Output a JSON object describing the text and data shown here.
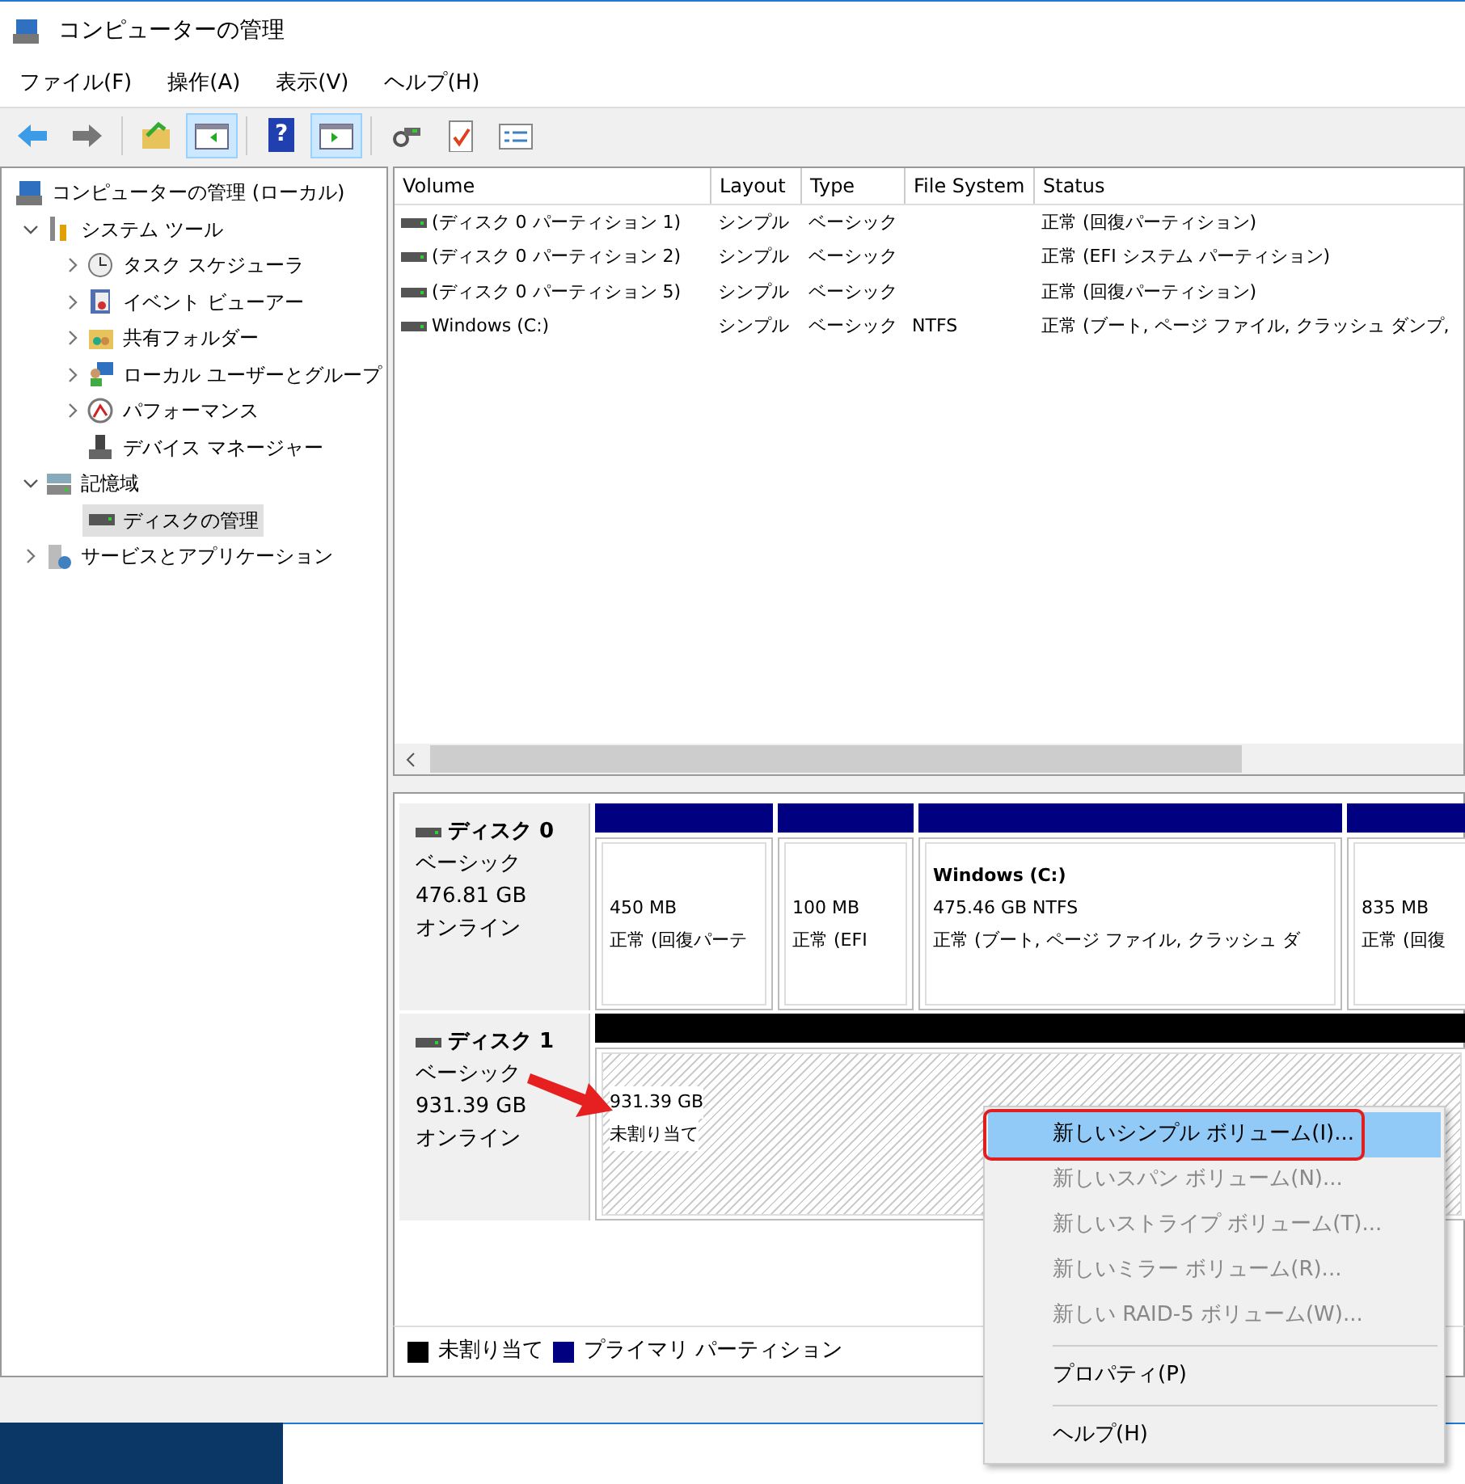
{
  "window": {
    "title": "コンピューターの管理"
  },
  "menu": [
    "ファイル(F)",
    "操作(A)",
    "表示(V)",
    "ヘルプ(H)"
  ],
  "toolbar": [
    {
      "kind": "back",
      "selected": false
    },
    {
      "kind": "forward",
      "selected": false
    },
    {
      "kind": "sep"
    },
    {
      "kind": "up",
      "selected": false
    },
    {
      "kind": "tree",
      "selected": true
    },
    {
      "kind": "sep"
    },
    {
      "kind": "help",
      "glyph": "?",
      "selected": false
    },
    {
      "kind": "pane",
      "selected": true
    },
    {
      "kind": "sep"
    },
    {
      "kind": "connect",
      "selected": false
    },
    {
      "kind": "check",
      "selected": false
    },
    {
      "kind": "list",
      "selected": false
    }
  ],
  "tree": [
    {
      "label": "コンピューターの管理 (ローカル)",
      "kind": "computer",
      "selected": false,
      "children": [
        {
          "label": "システム ツール",
          "kind": "tools",
          "expanded": true,
          "selected": false,
          "children": [
            {
              "label": "タスク スケジューラ",
              "kind": "clock",
              "expanded": false,
              "selected": false
            },
            {
              "label": "イベント ビューアー",
              "kind": "log",
              "expanded": false,
              "selected": false
            },
            {
              "label": "共有フォルダー",
              "kind": "folder",
              "expanded": false,
              "selected": false
            },
            {
              "label": "ローカル ユーザーとグループ",
              "kind": "users",
              "expanded": false,
              "selected": false
            },
            {
              "label": "パフォーマンス",
              "kind": "gauge",
              "expanded": false,
              "selected": false
            },
            {
              "label": "デバイス マネージャー",
              "kind": "device",
              "selected": false
            }
          ]
        },
        {
          "label": "記憶域",
          "kind": "storage",
          "expanded": true,
          "selected": false,
          "children": [
            {
              "label": "ディスクの管理",
              "kind": "disk",
              "selected": true
            }
          ]
        },
        {
          "label": "サービスとアプリケーション",
          "kind": "services",
          "expanded": false,
          "selected": false
        }
      ]
    }
  ],
  "volumes": {
    "columns": [
      "Volume",
      "Layout",
      "Type",
      "File System",
      "Status"
    ],
    "rows": [
      [
        "(ディスク 0 パーティション 1)",
        "シンプル",
        "ベーシック",
        "",
        "正常 (回復パーティション)"
      ],
      [
        "(ディスク 0 パーティション 2)",
        "シンプル",
        "ベーシック",
        "",
        "正常 (EFI システム パーティション)"
      ],
      [
        "(ディスク 0 パーティション 5)",
        "シンプル",
        "ベーシック",
        "",
        "正常 (回復パーティション)"
      ],
      [
        "Windows (C:)",
        "シンプル",
        "ベーシック",
        "NTFS",
        "正常 (ブート, ページ ファイル, クラッシュ ダンプ,"
      ]
    ]
  },
  "disks": [
    {
      "name": "ディスク 0",
      "type": "ベーシック",
      "size": "476.81 GB",
      "status": "オンライン",
      "partitions": [
        {
          "kind": "primary",
          "size": "450 MB",
          "status": "正常 (回復パーテ"
        },
        {
          "kind": "primary",
          "size": "100 MB",
          "status": "正常 (EFI"
        },
        {
          "kind": "primary",
          "name": "Windows  (C:)",
          "size": "475.46 GB NTFS",
          "status": "正常 (ブート, ページ ファイル, クラッシュ ダ"
        },
        {
          "kind": "primary",
          "size": "835 MB",
          "status": "正常 (回復"
        }
      ]
    },
    {
      "name": "ディスク 1",
      "type": "ベーシック",
      "size": "931.39 GB",
      "status": "オンライン",
      "partitions": [
        {
          "kind": "unallocated",
          "size": "931.39 GB",
          "status": "未割り当て"
        }
      ]
    }
  ],
  "legend": [
    {
      "label": "未割り当て",
      "color": "#000000"
    },
    {
      "label": "プライマリ パーティション",
      "color": "#000080"
    }
  ],
  "context_menu": [
    {
      "kind": "item",
      "label": "新しいシンプル ボリューム(I)...",
      "disabled": false,
      "selected": true,
      "outlined": true
    },
    {
      "kind": "item",
      "label": "新しいスパン ボリューム(N)...",
      "disabled": true,
      "selected": false,
      "outlined": false
    },
    {
      "kind": "item",
      "label": "新しいストライプ ボリューム(T)...",
      "disabled": true,
      "selected": false,
      "outlined": false
    },
    {
      "kind": "item",
      "label": "新しいミラー ボリューム(R)...",
      "disabled": true,
      "selected": false,
      "outlined": false
    },
    {
      "kind": "item",
      "label": "新しい RAID-5 ボリューム(W)...",
      "disabled": true,
      "selected": false,
      "outlined": false
    },
    {
      "kind": "separator"
    },
    {
      "kind": "item",
      "label": "プロパティ(P)",
      "disabled": false,
      "selected": false,
      "outlined": false
    },
    {
      "kind": "separator"
    },
    {
      "kind": "item",
      "label": "ヘルプ(H)",
      "disabled": false,
      "selected": false,
      "outlined": false
    }
  ]
}
